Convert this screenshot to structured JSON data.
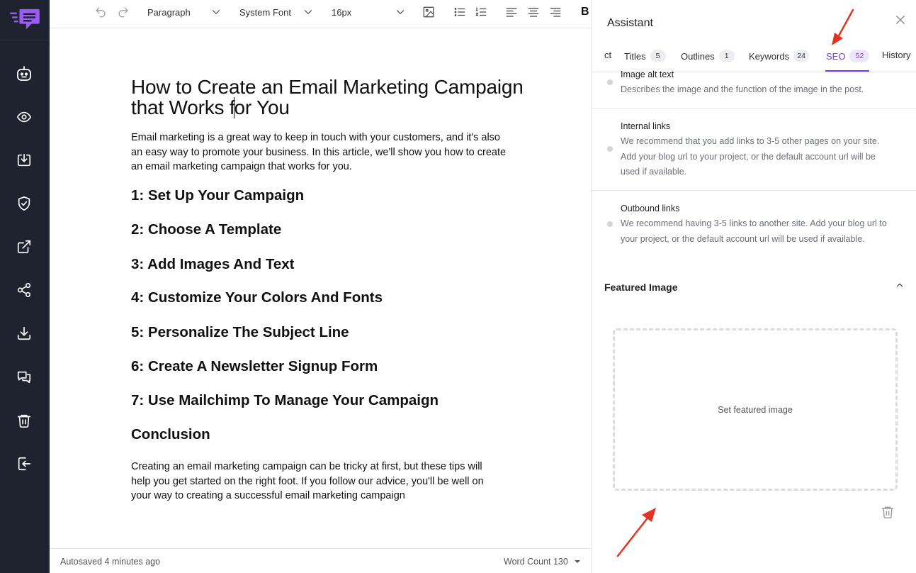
{
  "toolbar": {
    "block_type": "Paragraph",
    "font_family": "System Font",
    "font_size": "16px",
    "bold_label": "B"
  },
  "document": {
    "title_part1": "How to Create an Email Marketing Campaign that Works f",
    "title_part2": "or You",
    "intro": "Email marketing is a great way to keep in touch with your customers, and it's also an easy way to promote your business. In this article, we'll show you how to create an email marketing campaign that works for you.",
    "headings": [
      "1: Set Up Your Campaign",
      "2: Choose A Template",
      "3: Add Images And Text",
      "4: Customize Your Colors And Fonts",
      "5: Personalize The Subject Line",
      "6: Create A Newsletter Signup Form",
      "7: Use Mailchimp To Manage Your Campaign",
      "Conclusion"
    ],
    "conclusion": "Creating an email marketing campaign can be tricky at first, but these tips will help you get started on the right foot. If you follow our advice, you'll be well on your way to creating a successful email marketing campaign"
  },
  "footer": {
    "autosave": "Autosaved 4 minutes ago",
    "word_count": "Word Count 130"
  },
  "panel": {
    "title": "Assistant",
    "tabs": [
      {
        "label": "ct",
        "count": ""
      },
      {
        "label": "Titles",
        "count": "5"
      },
      {
        "label": "Outlines",
        "count": "1"
      },
      {
        "label": "Keywords",
        "count": "24"
      },
      {
        "label": "SEO",
        "count": "52"
      },
      {
        "label": "History",
        "count": ""
      }
    ],
    "active_tab": "SEO",
    "seo_items": [
      {
        "title": "Image alt text",
        "desc": "Describes the image and the function of the image in the post."
      },
      {
        "title": "Internal links",
        "desc": "We recommend that you add links to 3-5 other pages on your site. Add your blog url to your project, or the default account url will be used if available."
      },
      {
        "title": "Outbound links",
        "desc": "We recommend having 3-5 links to another site. Add your blog url to your project, or the default account url will be used if available."
      }
    ],
    "featured_image": {
      "title": "Featured Image",
      "placeholder": "Set featured image"
    }
  },
  "colors": {
    "sidebar_bg": "#1f2330",
    "brand": "#7c3aed",
    "annotation_arrow": "#e53222"
  },
  "icons": [
    "logo-icon",
    "bot-icon",
    "eye-icon",
    "import-icon",
    "shield-icon",
    "external-link-icon",
    "share-icon",
    "download-icon",
    "chat-icon",
    "trash-icon",
    "logout-icon"
  ]
}
